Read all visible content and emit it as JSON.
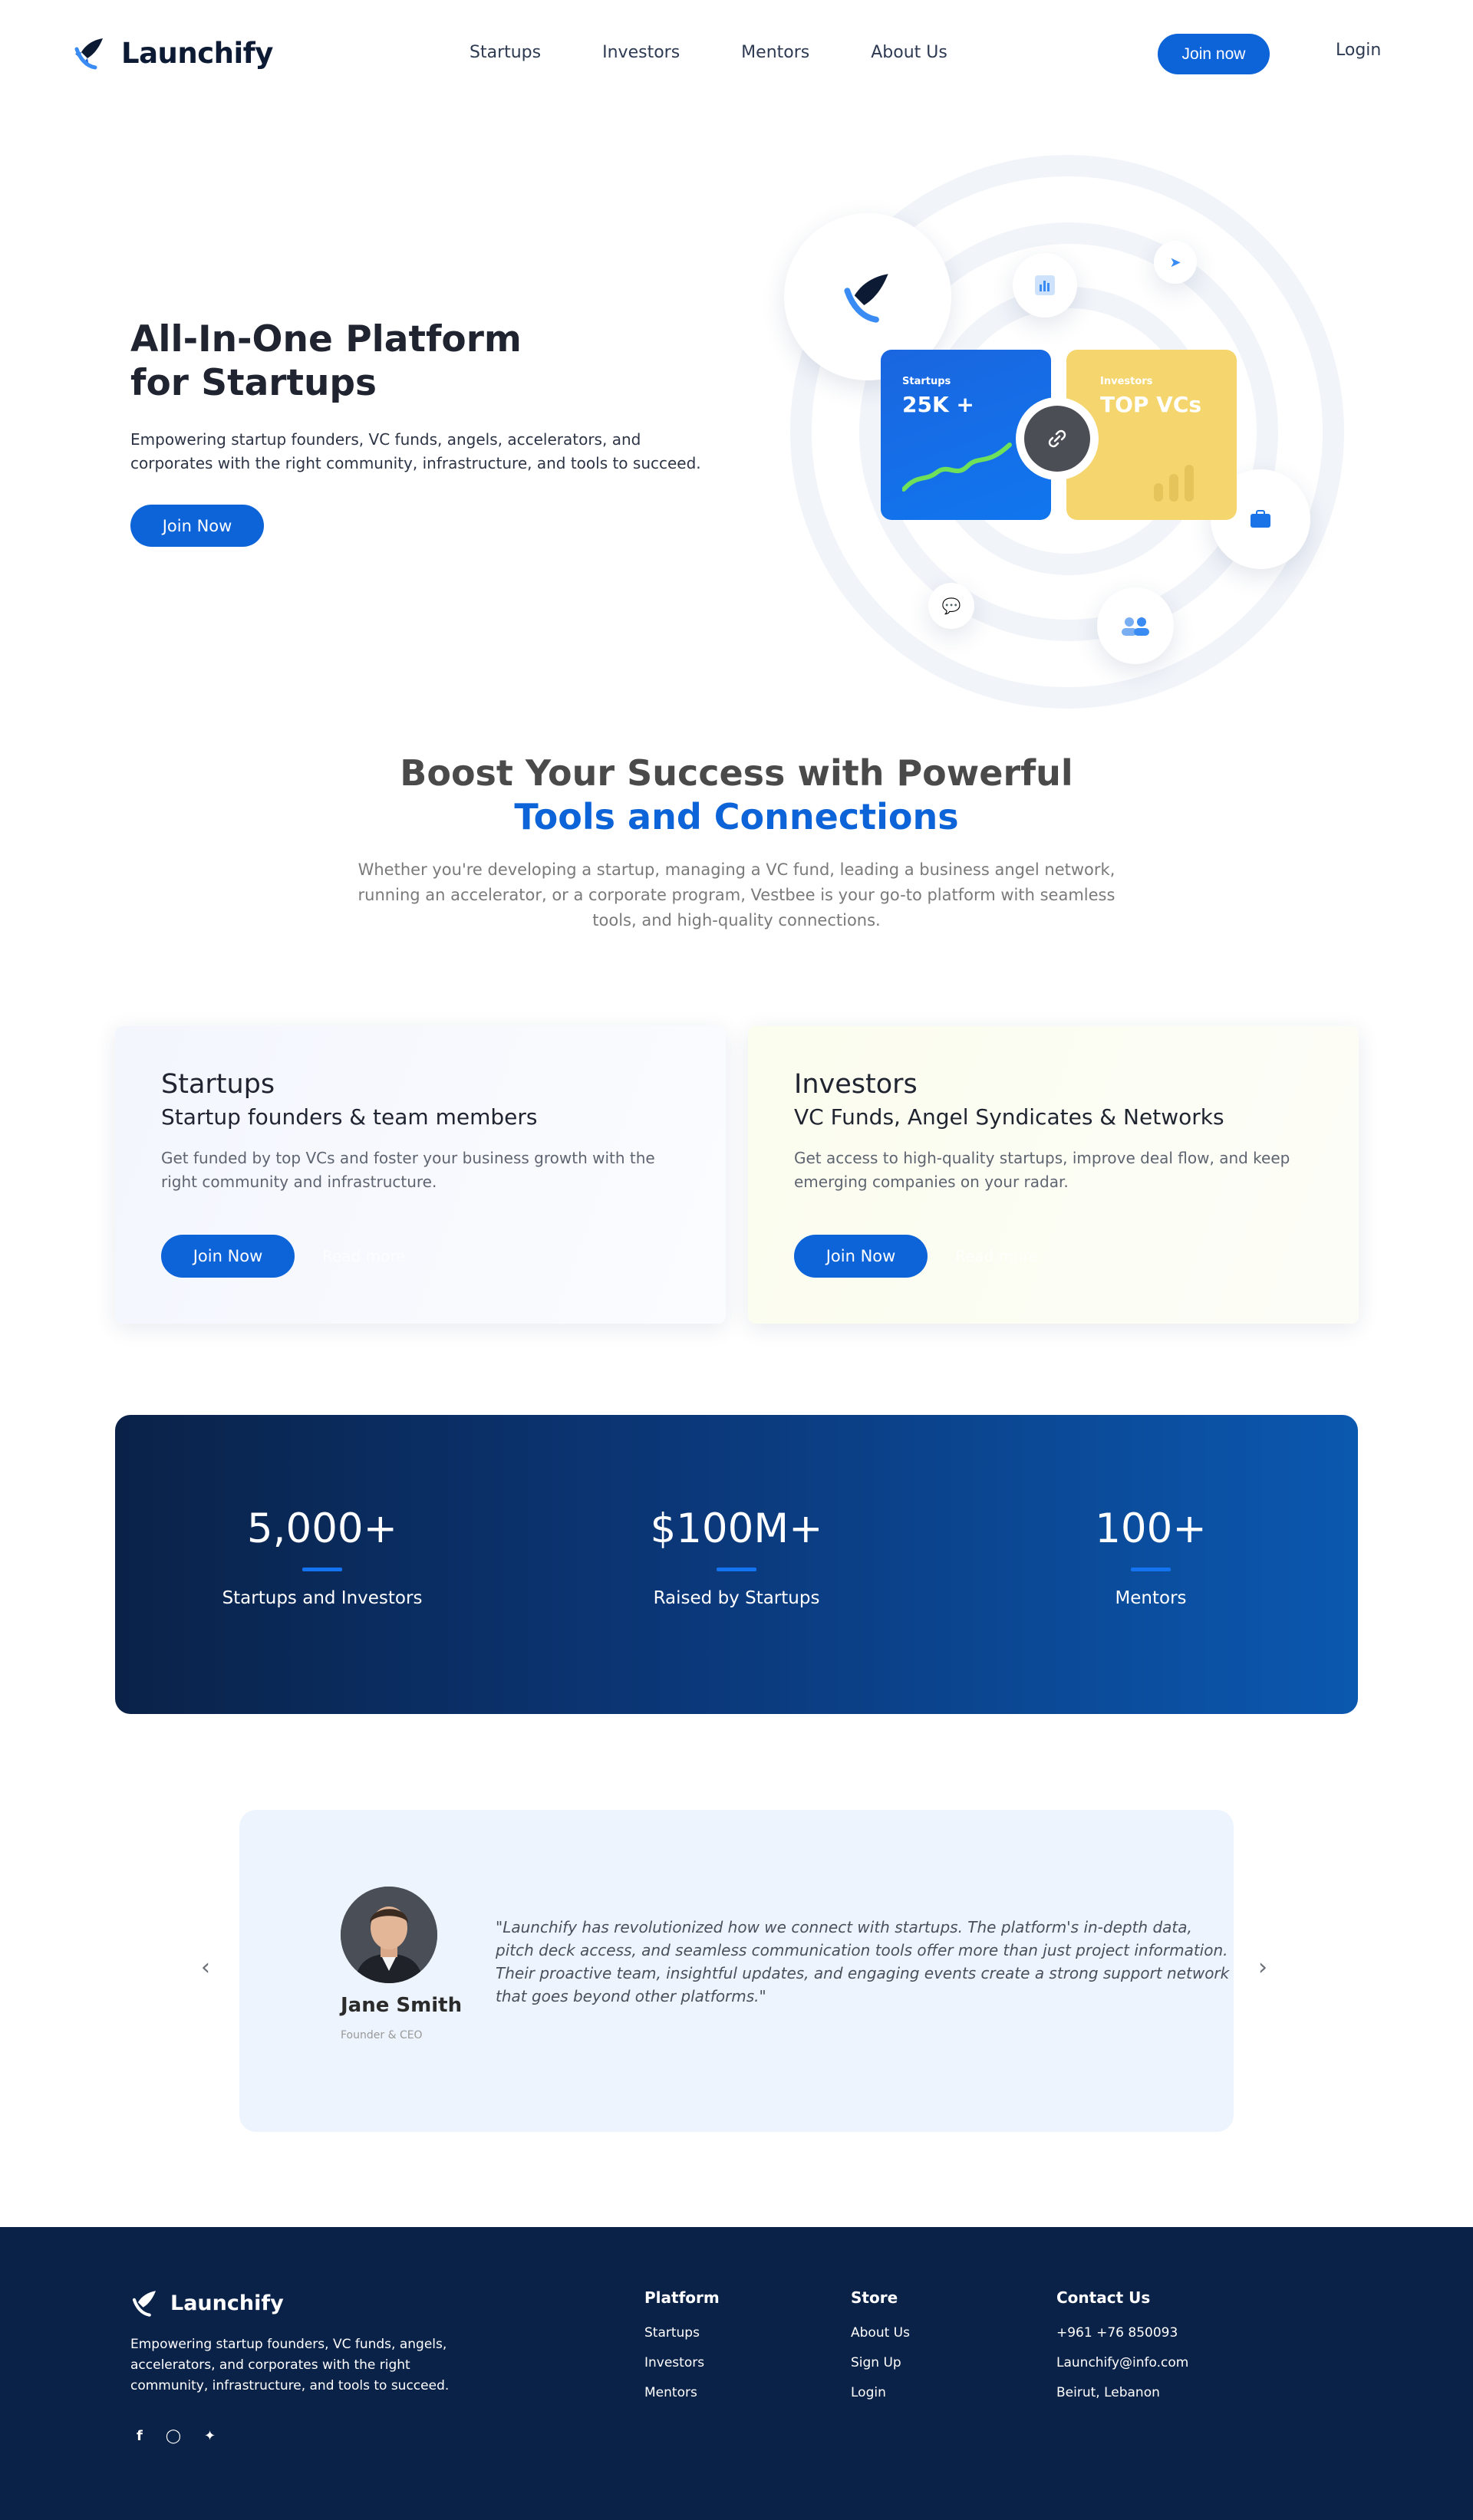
{
  "brand": {
    "name": "Launchify"
  },
  "nav": {
    "links": [
      "Startups",
      "Investors",
      "Mentors",
      "About Us"
    ],
    "join_label": "Join now",
    "login_label": "Login"
  },
  "hero": {
    "title_line1": "All-In-One Platform",
    "title_line2": "for Startups",
    "description": "Empowering startup founders, VC funds, angels, accelerators, and corporates with the right community, infrastructure, and tools to succeed.",
    "cta_label": "Join Now",
    "card_startups": {
      "label": "Startups",
      "value": "25K +"
    },
    "card_investors": {
      "label": "Investors",
      "value": "TOP VCs"
    }
  },
  "section": {
    "title_line1": "Boost Your Success with Powerful",
    "title_line2": "Tools and Connections",
    "description": "Whether you're developing a startup, managing a VC fund, leading a business angel network, running an accelerator, or a corporate program, Vestbee is your go-to platform with seamless tools, and high-quality connections."
  },
  "features": [
    {
      "title": "Startups",
      "subtitle": "Startup founders & team members",
      "description": "Get funded by top VCs and foster your business growth with the right community and infrastructure.",
      "cta_label": "Join Now",
      "secondary_label": "Read more"
    },
    {
      "title": "Investors",
      "subtitle": "VC Funds, Angel Syndicates & Networks",
      "description": "Get access to high-quality startups, improve deal flow, and keep emerging companies on your radar.",
      "cta_label": "Join Now",
      "secondary_label": "Read more"
    }
  ],
  "stats": [
    {
      "value": "5,000+",
      "label": "Startups and Investors"
    },
    {
      "value": "$100M+",
      "label": "Raised by Startups"
    },
    {
      "value": "100+",
      "label": "Mentors"
    }
  ],
  "testimonial": {
    "name": "Jane Smith",
    "role": "Founder & CEO",
    "quote": "\"Launchify has revolutionized how we connect with startups. The platform's in-depth data, pitch deck access, and seamless communication tools offer more than just project information. Their proactive team, insightful updates, and engaging events create a strong support network that goes beyond other platforms.\""
  },
  "footer": {
    "brand": "Launchify",
    "about": "Empowering startup founders, VC funds, angels, accelerators, and corporates with the right community, infrastructure, and tools to succeed.",
    "social_icons": [
      "facebook-icon",
      "instagram-icon",
      "twitter-icon"
    ],
    "platform": {
      "title": "Platform",
      "items": [
        "Startups",
        "Investors",
        "Mentors"
      ]
    },
    "store": {
      "title": "Store",
      "items": [
        "About Us",
        "Sign Up",
        "Login"
      ]
    },
    "contact": {
      "title": "Contact Us",
      "items": [
        "+961 +76 850093",
        "Launchify@info.com",
        "Beirut, Lebanon"
      ]
    }
  },
  "colors": {
    "primary": "#0d63d8",
    "navy": "#0b2248",
    "yellow": "#f5d66e"
  }
}
